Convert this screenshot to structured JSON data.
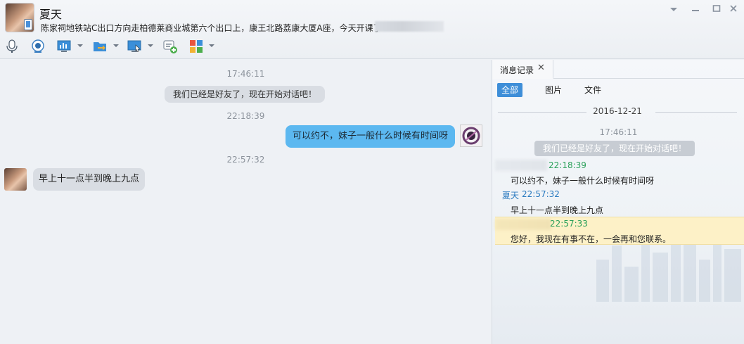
{
  "header": {
    "contact_name": "夏天",
    "status_text": "陈家祠地铁站C出口方向走柏德莱商业城第六个出口上，康王北路荔康大厦A座，今天开课了"
  },
  "window_controls": {
    "dropdown_icon": "chevron-down-icon",
    "minimize_icon": "minimize-icon",
    "maximize_icon": "maximize-icon",
    "close_icon": "close-icon"
  },
  "toolbar": {
    "items": [
      "voice-call-icon",
      "video-call-icon",
      "screen-share-icon",
      "file-transfer-icon",
      "remote-desktop-icon",
      "add-app-icon",
      "apps-grid-icon"
    ]
  },
  "chat": {
    "messages": [
      {
        "time": "17:46:11",
        "text": "我们已经是好友了，现在开始对话吧！",
        "kind": "system"
      },
      {
        "time": "22:18:39",
        "text": "可以约不，妹子一般什么时候有时间呀",
        "kind": "sent"
      },
      {
        "time": "22:57:32",
        "text": "早上十一点半到晚上九点",
        "kind": "received"
      }
    ]
  },
  "history": {
    "tab_label": "消息记录",
    "filters": [
      "全部",
      "图片",
      "文件"
    ],
    "date": "2016-12-21",
    "entries": [
      {
        "time": "17:46:11",
        "text": "我们已经是好友了，现在开始对话吧！"
      },
      {
        "sender": "",
        "time": "22:18:39",
        "text": "可以约不，妹子一般什么时候有时间呀"
      },
      {
        "sender": "夏天",
        "time": "22:57:32",
        "text": "早上十一点半到晚上九点"
      },
      {
        "sender": "",
        "time": "22:57:33",
        "text": "您好，我现在有事不在，一会再和您联系。"
      }
    ]
  },
  "colors": {
    "accent": "#3e8ed8",
    "sent_bubble": "#5cb8f0",
    "peer_name": "#2a7ac0",
    "self_time": "#2aa05a",
    "auto_reply_bg": "#fdf1c7"
  }
}
